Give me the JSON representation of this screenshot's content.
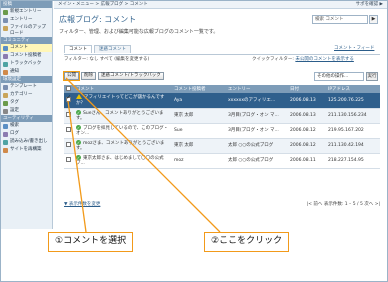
{
  "topbar": {
    "breadcrumb": "メイン・メニュー > 広報ブログ > コメント",
    "right": "サポを確認 ▶"
  },
  "sidebar": {
    "sections": [
      {
        "title": "投稿",
        "items": [
          "新規エントリー",
          "エントリー",
          "ファイルのアップロード"
        ]
      },
      {
        "title": "コミュニティ",
        "items": [
          "コメント",
          "コメント投稿者",
          "トラックバック",
          "通知"
        ]
      },
      {
        "title": "環境設定",
        "items": [
          "テンプレート",
          "カテゴリー",
          "タグ",
          "設定"
        ]
      },
      {
        "title": "ユーティリティ",
        "items": [
          "検索",
          "ログ",
          "読み込み/書き出し",
          "サイトを再構築"
        ]
      }
    ],
    "active_item": "コメント"
  },
  "page": {
    "title": "広報ブログ: コメント",
    "search_value": "検索 コメント",
    "search_button": "▶",
    "description": "フィルター、管理、および編集可能な広報ブログのコメント一覧です。",
    "tabs": [
      "コメント",
      "迷惑コメント"
    ],
    "feed_link": "コメント・フィード",
    "filter_label": "フィルター:",
    "filter_value": "なし すべて (編集を変更する)",
    "quick_label": "クイックフィルター:",
    "quick_value": "未公開のコメントを表示する"
  },
  "actions": {
    "publish": "公開",
    "delete": "削除",
    "spam": "迷惑コメント/トラックバック",
    "ops_select": "その他の操作...",
    "ops_button": "実行"
  },
  "table": {
    "headers": [
      "",
      "コメント",
      "コメント投稿者",
      "エントリー",
      "日付",
      "IPアドレス"
    ],
    "rows": [
      {
        "checked": true,
        "status": "warn",
        "comment": "アフィリエイトってどこが儲かるんですか？",
        "author": "Aya",
        "entry": "xxxxxxのアフィリエ...",
        "date": "2006.08.13",
        "ip": "125.200.76.225"
      },
      {
        "checked": false,
        "status": "ok",
        "comment": "Sueさん、コメントありがとうございます。",
        "author": "東京 太郎",
        "entry": "3月目(ブログ・オン マ...",
        "date": "2006.08.13",
        "ip": "211.130.156.234"
      },
      {
        "checked": false,
        "status": "ok",
        "comment": "ブログを拝見しているので、このブログ・オン...",
        "author": "Sue",
        "entry": "3月目(ブログ・オン マ...",
        "date": "2006.08.12",
        "ip": "219.95.167.202"
      },
      {
        "checked": false,
        "status": "ok",
        "comment": "mozさま、コメントありがとうございます。",
        "author": "東京 太郎",
        "entry": "太郎 ○○の公式ブログ",
        "date": "2006.08.12",
        "ip": "211.130.42.194"
      },
      {
        "checked": false,
        "status": "ok",
        "comment": "東京太郎さま、はじめまして〇〇の公式ブ...",
        "author": "moz",
        "entry": "太郎 ○○の公式ブログ",
        "date": "2006.08.11",
        "ip": "218.227.154.95"
      }
    ]
  },
  "pager": {
    "left": "▼ 表示件数を変更",
    "right": "|< 前へ 表示件数: 1 – 5 / 5 次へ >|"
  },
  "callouts": {
    "first": "①コメントを選択",
    "second": "②ここをクリック"
  },
  "colors": {
    "accent": "#f29a1a",
    "header": "#7d9cb8",
    "selected": "#2f5f8c"
  }
}
